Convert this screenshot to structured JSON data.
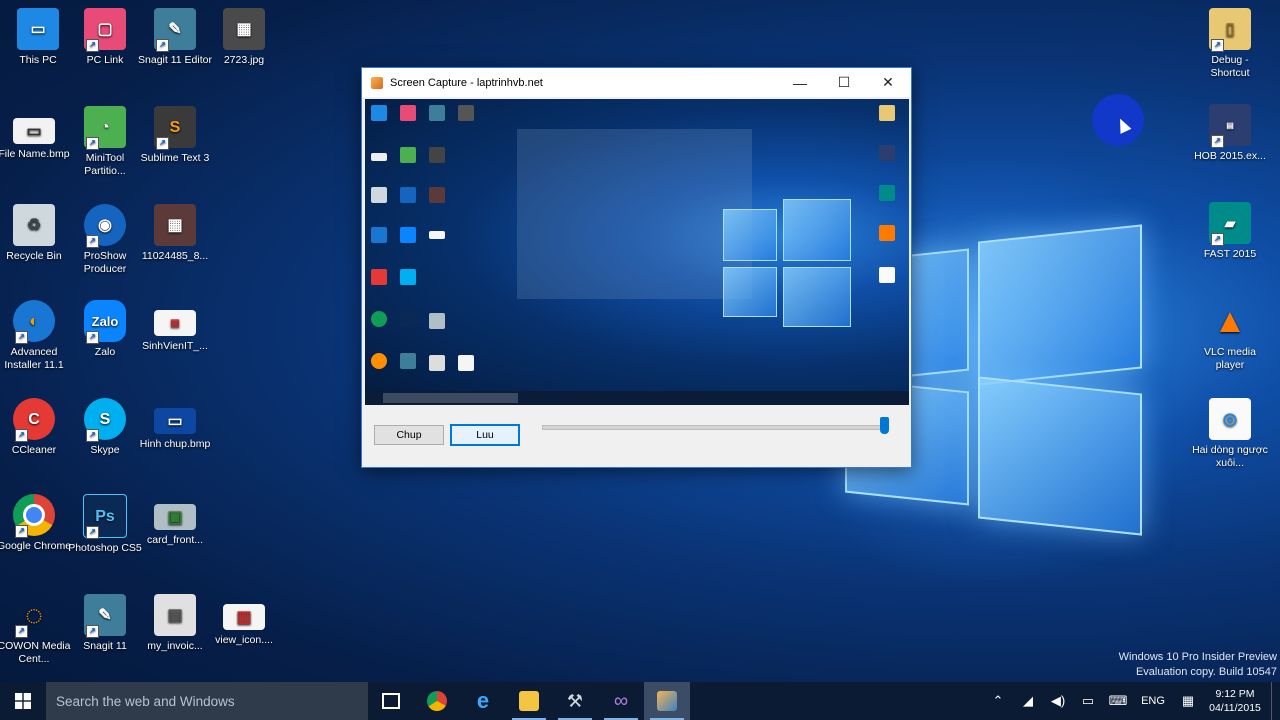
{
  "desktop": {
    "left_icons": [
      {
        "label": "This PC",
        "icon": "this-pc-icon"
      },
      {
        "label": "PC Link",
        "icon": "pc-link-icon"
      },
      {
        "label": "Snagit 11 Editor",
        "icon": "snagit-editor-icon"
      },
      {
        "label": "2723.jpg",
        "icon": "image-file-icon"
      },
      {
        "label": "File Name.bmp",
        "icon": "bitmap-file-icon"
      },
      {
        "label": "MiniTool Partitio...",
        "icon": "minitool-icon"
      },
      {
        "label": "Sublime Text 3",
        "icon": "sublime-text-icon"
      },
      {
        "label": "Recycle Bin",
        "icon": "recycle-bin-icon"
      },
      {
        "label": "ProShow Producer",
        "icon": "proshow-icon"
      },
      {
        "label": "11024485_8...",
        "icon": "image-file-icon"
      },
      {
        "label": "Advanced Installer 11.1",
        "icon": "advanced-installer-icon"
      },
      {
        "label": "Zalo",
        "icon": "zalo-icon"
      },
      {
        "label": "SinhVienIT_...",
        "icon": "sinhvienit-file-icon"
      },
      {
        "label": "CCleaner",
        "icon": "ccleaner-icon"
      },
      {
        "label": "Skype",
        "icon": "skype-icon"
      },
      {
        "label": "Hinh chup.bmp",
        "icon": "bitmap-file-icon"
      },
      {
        "label": "Google Chrome",
        "icon": "chrome-icon"
      },
      {
        "label": "Photoshop CS5",
        "icon": "photoshop-icon"
      },
      {
        "label": "card_front...",
        "icon": "card-file-icon"
      },
      {
        "label": "COWON Media Cent...",
        "icon": "cowon-icon"
      },
      {
        "label": "Snagit 11",
        "icon": "snagit-icon"
      },
      {
        "label": "my_invoic...",
        "icon": "invoice-file-icon"
      },
      {
        "label": "view_icon....",
        "icon": "view-icon-file-icon"
      }
    ],
    "right_icons": [
      {
        "label": "Debug - Shortcut",
        "icon": "folder-icon"
      },
      {
        "label": "HOB 2015.ex...",
        "icon": "hob-icon"
      },
      {
        "label": "FAST 2015",
        "icon": "fast-icon"
      },
      {
        "label": "VLC media player",
        "icon": "vlc-icon"
      },
      {
        "label": "Hai dòng ngược xuôi...",
        "icon": "audio-file-icon"
      }
    ]
  },
  "capture_window": {
    "title": "Screen Capture - laptrinhvb.net",
    "capture_button": "Chup",
    "save_button": "Luu",
    "slider_level": 1.0
  },
  "watermark": {
    "line1": "Windows 10 Pro Insider Preview",
    "line2": "Evaluation copy. Build 10547"
  },
  "taskbar": {
    "search_placeholder": "Search the web and Windows",
    "language": "ENG",
    "time": "9:12 PM",
    "date": "04/11/2015"
  },
  "colors": {
    "accent": "#0078d7",
    "taskbar": "#0b1b33"
  }
}
